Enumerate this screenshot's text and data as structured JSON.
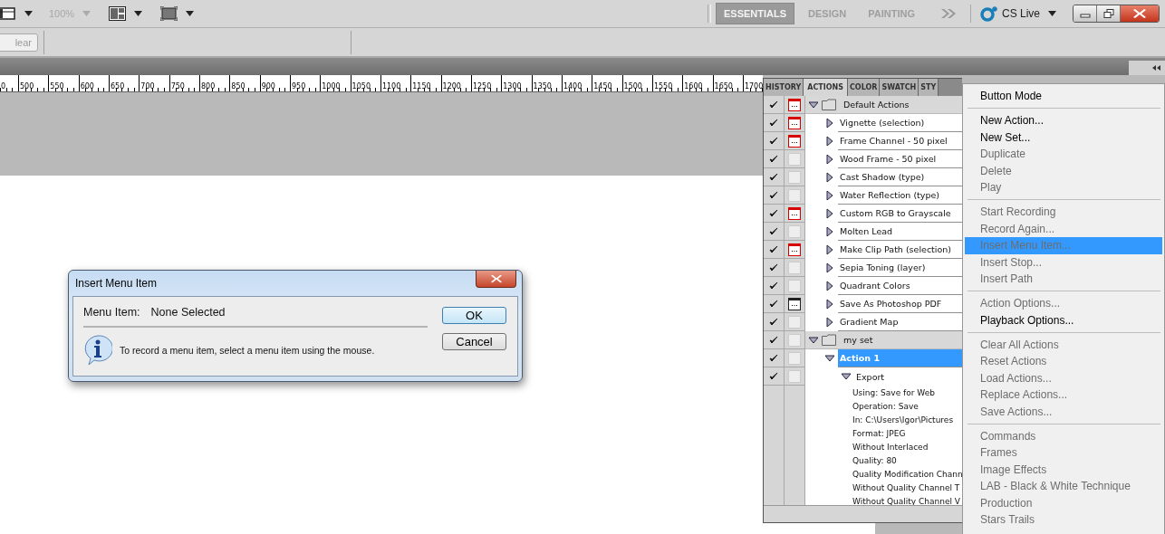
{
  "toolbar": {
    "zoom": {
      "label": "100%",
      "disabled": true
    }
  },
  "workspaces": [
    {
      "label": "ESSENTIALS",
      "selected": true
    },
    {
      "label": "DESIGN",
      "selected": false
    },
    {
      "label": "PAINTING",
      "selected": false
    }
  ],
  "cs_live": "CS Live",
  "options_bar": {
    "button": "lear"
  },
  "ruler": [
    "0",
    "500",
    "550",
    "600",
    "650",
    "700",
    "750",
    "800",
    "850",
    "900",
    "950",
    "1000",
    "1050",
    "1100",
    "1150",
    "1200",
    "1250",
    "1300",
    "1350",
    "1400",
    "1450",
    "1500",
    "1550",
    "1600",
    "1650",
    "1700"
  ],
  "panel": {
    "tabs": [
      {
        "label": "HISTORY",
        "selected": false
      },
      {
        "label": "ACTIONS",
        "selected": true
      },
      {
        "label": "COLOR",
        "selected": false
      },
      {
        "label": "SWATCH",
        "selected": false
      },
      {
        "label": "STY",
        "selected": false
      }
    ],
    "items": [
      {
        "kind": "set",
        "label": "Default Actions",
        "checked": true,
        "dialog_on": true,
        "dialog_mixed": true,
        "expanded": true,
        "selected": false,
        "children": [
          {
            "kind": "action",
            "label": "Vignette (selection)",
            "checked": true,
            "dialog_on": true,
            "dialog_mixed": true,
            "expanded": false,
            "selected": false
          },
          {
            "kind": "action",
            "label": "Frame Channel - 50 pixel",
            "checked": true,
            "dialog_on": true,
            "dialog_mixed": true,
            "expanded": false,
            "selected": false
          },
          {
            "kind": "action",
            "label": "Wood Frame - 50 pixel",
            "checked": true,
            "dialog_on": false,
            "expanded": false,
            "selected": false
          },
          {
            "kind": "action",
            "label": "Cast Shadow (type)",
            "checked": true,
            "dialog_on": false,
            "expanded": false,
            "selected": false
          },
          {
            "kind": "action",
            "label": "Water Reflection (type)",
            "checked": true,
            "dialog_on": false,
            "expanded": false,
            "selected": false
          },
          {
            "kind": "action",
            "label": "Custom RGB to Grayscale",
            "checked": true,
            "dialog_on": true,
            "dialog_mixed": true,
            "expanded": false,
            "selected": false
          },
          {
            "kind": "action",
            "label": "Molten Lead",
            "checked": true,
            "dialog_on": false,
            "expanded": false,
            "selected": false
          },
          {
            "kind": "action",
            "label": "Make Clip Path (selection)",
            "checked": true,
            "dialog_on": true,
            "dialog_mixed": true,
            "expanded": false,
            "selected": false
          },
          {
            "kind": "action",
            "label": "Sepia Toning (layer)",
            "checked": true,
            "dialog_on": false,
            "expanded": false,
            "selected": false
          },
          {
            "kind": "action",
            "label": "Quadrant Colors",
            "checked": true,
            "dialog_on": false,
            "expanded": false,
            "selected": false
          },
          {
            "kind": "action",
            "label": "Save As Photoshop PDF",
            "checked": true,
            "dialog_on": true,
            "dialog_mixed": false,
            "expanded": false,
            "selected": false
          },
          {
            "kind": "action",
            "label": "Gradient Map",
            "checked": true,
            "dialog_on": false,
            "expanded": false,
            "selected": false
          }
        ]
      },
      {
        "kind": "set",
        "label": "my set",
        "checked": true,
        "dialog_on": false,
        "expanded": true,
        "selected": false,
        "children": [
          {
            "kind": "action",
            "label": "Action 1",
            "checked": true,
            "dialog_on": false,
            "expanded": true,
            "selected": true,
            "children": [
              {
                "kind": "command",
                "label": "Export",
                "checked": true,
                "dialog_on": false,
                "expanded": true,
                "selected": false,
                "children": [
                  {
                    "kind": "setting",
                    "label": "Using: Save for Web",
                    "selected": false
                  },
                  {
                    "kind": "setting",
                    "label": "Operation: Save",
                    "selected": false
                  },
                  {
                    "kind": "setting",
                    "label": "In: C:\\Users\\Igor\\Pictures",
                    "selected": false
                  },
                  {
                    "kind": "setting",
                    "label": "Format: JPEG",
                    "selected": false
                  },
                  {
                    "kind": "setting",
                    "label": "Without Interlaced",
                    "selected": false
                  },
                  {
                    "kind": "setting",
                    "label": "Quality: 80",
                    "selected": false
                  },
                  {
                    "kind": "setting",
                    "label": "Quality Modification Chann",
                    "selected": false
                  },
                  {
                    "kind": "setting",
                    "label": "Without Quality Channel T",
                    "selected": false
                  },
                  {
                    "kind": "setting",
                    "label": "Without Quality Channel V",
                    "selected": false
                  }
                ]
              }
            ]
          }
        ]
      }
    ]
  },
  "menu": {
    "sections": [
      [
        {
          "label": "Button Mode",
          "disabled": false,
          "selected": false
        }
      ],
      [
        {
          "label": "New Action...",
          "disabled": false,
          "selected": false
        },
        {
          "label": "New Set...",
          "disabled": false,
          "selected": false
        },
        {
          "label": "Duplicate",
          "disabled": true,
          "selected": false
        },
        {
          "label": "Delete",
          "disabled": true,
          "selected": false
        },
        {
          "label": "Play",
          "disabled": true,
          "selected": false
        }
      ],
      [
        {
          "label": "Start Recording",
          "disabled": true,
          "selected": false
        },
        {
          "label": "Record Again...",
          "disabled": true,
          "selected": false
        },
        {
          "label": "Insert Menu Item...",
          "disabled": true,
          "selected": true
        },
        {
          "label": "Insert Stop...",
          "disabled": true,
          "selected": false
        },
        {
          "label": "Insert Path",
          "disabled": true,
          "selected": false
        }
      ],
      [
        {
          "label": "Action Options...",
          "disabled": true,
          "selected": false
        },
        {
          "label": "Playback Options...",
          "disabled": false,
          "selected": false
        }
      ],
      [
        {
          "label": "Clear All Actions",
          "disabled": true,
          "selected": false
        },
        {
          "label": "Reset Actions",
          "disabled": true,
          "selected": false
        },
        {
          "label": "Load Actions...",
          "disabled": true,
          "selected": false
        },
        {
          "label": "Replace Actions...",
          "disabled": true,
          "selected": false
        },
        {
          "label": "Save Actions...",
          "disabled": true,
          "selected": false
        }
      ],
      [
        {
          "label": "Commands",
          "disabled": true,
          "selected": false
        },
        {
          "label": "Frames",
          "disabled": true,
          "selected": false
        },
        {
          "label": "Image Effects",
          "disabled": true,
          "selected": false
        },
        {
          "label": "LAB - Black & White Technique",
          "disabled": true,
          "selected": false
        },
        {
          "label": "Production",
          "disabled": true,
          "selected": false
        },
        {
          "label": "Stars Trails",
          "disabled": true,
          "selected": false
        }
      ]
    ]
  },
  "dialog": {
    "title": "Insert Menu Item",
    "field_label": "Menu Item:",
    "field_value": "None Selected",
    "message": "To record a menu item, select a menu item using the mouse.",
    "buttons": [
      {
        "label": "OK",
        "default": true
      },
      {
        "label": "Cancel",
        "default": false
      }
    ]
  }
}
